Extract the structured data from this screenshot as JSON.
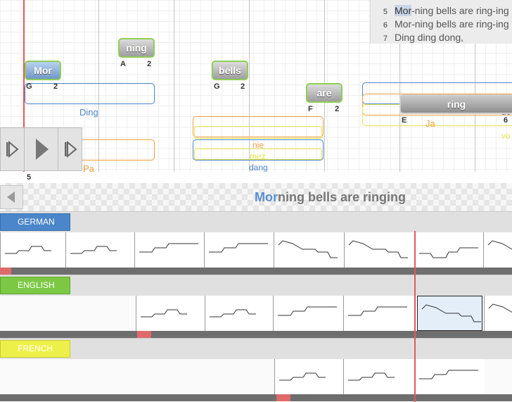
{
  "lyrics_list": {
    "lines": [
      {
        "num": "",
        "text": ""
      },
      {
        "num": "5",
        "pre": "",
        "highlight": "Mor",
        "post": "-ning bells are ring-ing"
      },
      {
        "num": "6",
        "pre": "Mor-ning bells are ring-ing",
        "highlight": "",
        "post": ""
      },
      {
        "num": "7",
        "pre": "Ding ding dong,",
        "highlight": "",
        "post": ""
      }
    ]
  },
  "notes": [
    {
      "syllable": "Mor",
      "pitch": "G",
      "duration": "2"
    },
    {
      "syllable": "ning",
      "pitch": "A",
      "duration": "2"
    },
    {
      "syllable": "bells",
      "pitch": "G",
      "duration": "2"
    },
    {
      "syllable": "are",
      "pitch": "F",
      "duration": "2"
    },
    {
      "syllable": "ring",
      "pitch": "E",
      "duration": "6"
    }
  ],
  "other_lyrics": {
    "ding": "Ding",
    "pa": "Pa",
    "nie": "nie",
    "mez": "mez",
    "dang": "dang",
    "ja": "Ja",
    "de": "de",
    "vo": "vo"
  },
  "ruler": {
    "measure": "5"
  },
  "current_line": {
    "sung": "Mor",
    "rest": "ning bells are ringing"
  },
  "tracks": [
    {
      "label": "GERMAN",
      "color": "#4a86c9",
      "text_color": "#ffffff"
    },
    {
      "label": "ENGLISH",
      "color": "#7cc844",
      "text_color": "#ffffff"
    },
    {
      "label": "FRENCH",
      "color": "#eef04a",
      "text_color": "#ffffff"
    }
  ],
  "colors": {
    "blue": "#4a86c9",
    "orange": "#f0a040",
    "yellow": "#e6e64a",
    "playhead": "#e05a5a",
    "sung_text": "#5b8fcf"
  }
}
